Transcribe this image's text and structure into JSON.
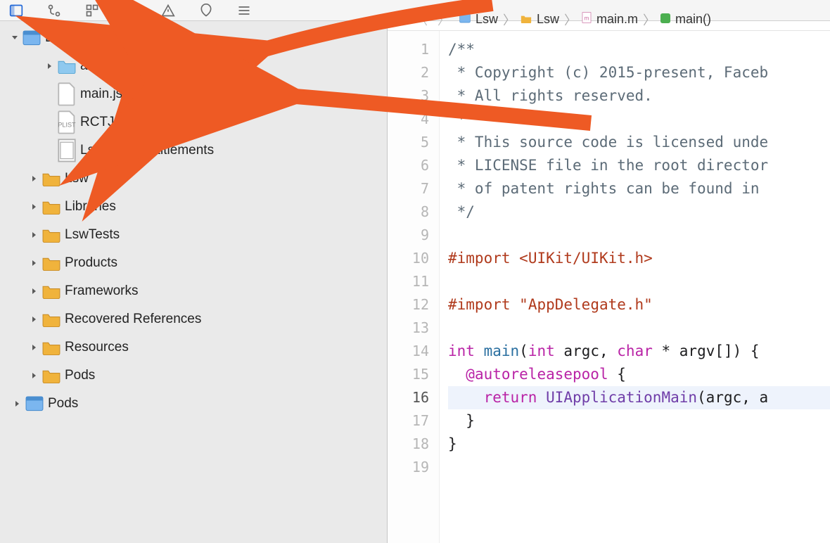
{
  "breadcrumb": [
    "Lsw",
    "Lsw",
    "main.m",
    "main()"
  ],
  "navigator": {
    "project": {
      "name": "Lsw",
      "icon": "xcodeproj"
    },
    "groups": [
      {
        "name": "assets",
        "icon": "folder-blue",
        "expandable": true,
        "expanded": false,
        "indent": 2
      },
      {
        "name": "main.jsbundle",
        "icon": "file",
        "expandable": false,
        "indent": 2
      },
      {
        "name": "RCTJShareConfig.plist",
        "icon": "plist",
        "expandable": false,
        "indent": 2
      },
      {
        "name": "Lsw-tvOS.entitlements",
        "icon": "entitlements",
        "expandable": false,
        "indent": 2
      },
      {
        "name": "Lsw",
        "icon": "folder",
        "expandable": true,
        "expanded": false,
        "indent": 1
      },
      {
        "name": "Libraries",
        "icon": "folder",
        "expandable": true,
        "expanded": false,
        "indent": 1
      },
      {
        "name": "LswTests",
        "icon": "folder",
        "expandable": true,
        "expanded": false,
        "indent": 1
      },
      {
        "name": "Products",
        "icon": "folder",
        "expandable": true,
        "expanded": false,
        "indent": 1
      },
      {
        "name": "Frameworks",
        "icon": "folder",
        "expandable": true,
        "expanded": false,
        "indent": 1
      },
      {
        "name": "Recovered References",
        "icon": "folder",
        "expandable": true,
        "expanded": false,
        "indent": 1
      },
      {
        "name": "Resources",
        "icon": "folder",
        "expandable": true,
        "expanded": false,
        "indent": 1
      },
      {
        "name": "Pods",
        "icon": "folder",
        "expandable": true,
        "expanded": false,
        "indent": 1
      }
    ],
    "siblingProject": {
      "name": "Pods",
      "icon": "xcodeproj"
    }
  },
  "code": {
    "lines": [
      {
        "n": 1,
        "html": "<span class='tok-cmt'>/**</span>"
      },
      {
        "n": 2,
        "html": "<span class='tok-cmt'> * Copyright (c) 2015-present, Faceb</span>"
      },
      {
        "n": 3,
        "html": "<span class='tok-cmt'> * All rights reserved.</span>"
      },
      {
        "n": 4,
        "html": "<span class='tok-cmt'> *</span>"
      },
      {
        "n": 5,
        "html": "<span class='tok-cmt'> * This source code is licensed unde</span>"
      },
      {
        "n": 6,
        "html": "<span class='tok-cmt'> * LICENSE file in the root director</span>"
      },
      {
        "n": 7,
        "html": "<span class='tok-cmt'> * of patent rights can be found in </span>"
      },
      {
        "n": 8,
        "html": "<span class='tok-cmt'> */</span>"
      },
      {
        "n": 9,
        "html": ""
      },
      {
        "n": 10,
        "html": "<span class='tok-pre'>#import</span> <span class='tok-inc'>&lt;UIKit/UIKit.h&gt;</span>"
      },
      {
        "n": 11,
        "html": ""
      },
      {
        "n": 12,
        "html": "<span class='tok-pre'>#import</span> <span class='tok-str'>\"AppDelegate.h\"</span>"
      },
      {
        "n": 13,
        "html": ""
      },
      {
        "n": 14,
        "html": "<span class='tok-kw'>int</span> <span class='tok-id'>main</span>(<span class='tok-kw'>int</span> argc, <span class='tok-kw'>char</span> * argv[]) {"
      },
      {
        "n": 15,
        "html": "  <span class='tok-at'>@autoreleasepool</span> {"
      },
      {
        "n": 16,
        "html": "    <span class='tok-kw'>return</span> <span class='tok-ty'>UIApplicationMain</span>(argc, a",
        "highlight": true
      },
      {
        "n": 17,
        "html": "  }"
      },
      {
        "n": 18,
        "html": "}"
      },
      {
        "n": 19,
        "html": ""
      }
    ]
  }
}
